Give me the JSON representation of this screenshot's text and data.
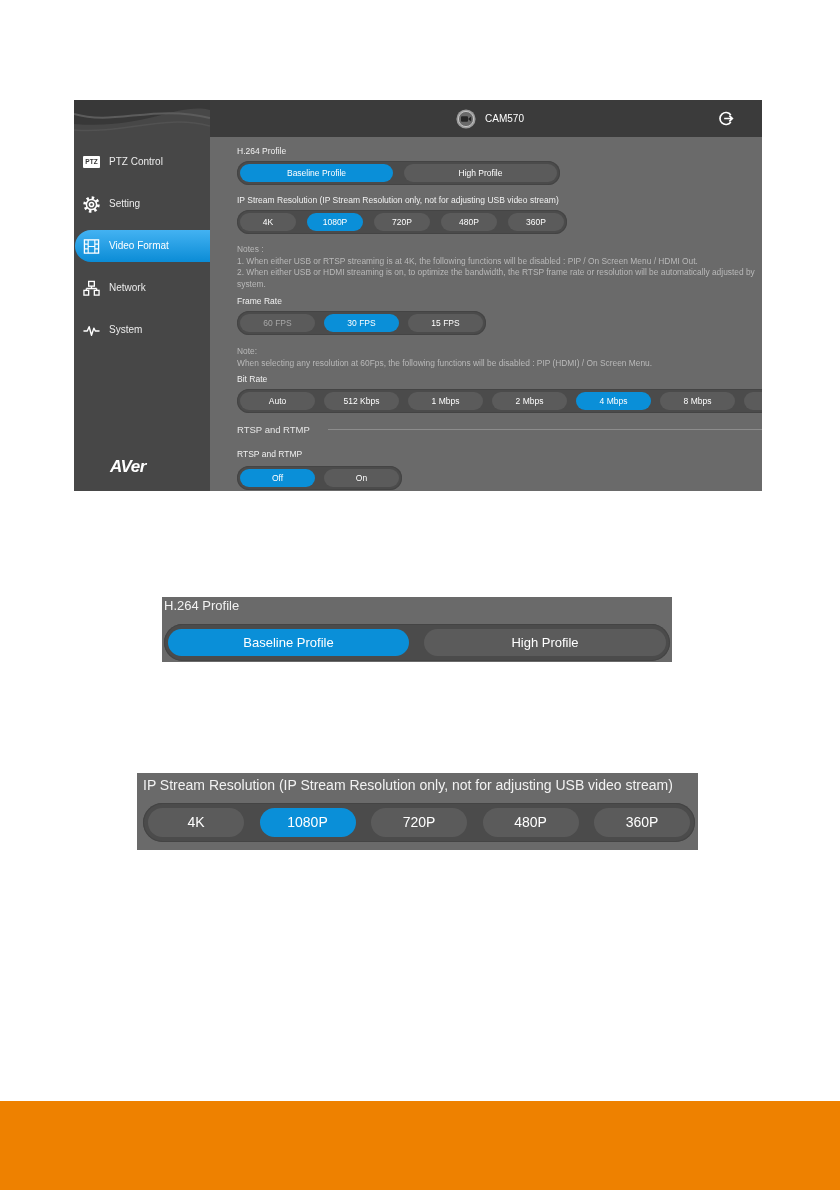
{
  "app_screenshot": {
    "sidebar": {
      "items": [
        {
          "label": "PTZ Control",
          "icon_text": "PTZ",
          "selected": false
        },
        {
          "label": "Setting",
          "selected": false
        },
        {
          "label": "Video Format",
          "selected": true
        },
        {
          "label": "Network",
          "selected": false
        },
        {
          "label": "System",
          "selected": false
        }
      ],
      "logo": "AVer"
    },
    "header": {
      "device_name": "CAM570"
    },
    "h264_profile": {
      "label": "H.264 Profile",
      "options": [
        {
          "label": "Baseline Profile",
          "selected": true
        },
        {
          "label": "High Profile",
          "selected": false
        }
      ]
    },
    "ip_stream_resolution": {
      "label": "IP Stream Resolution (IP Stream Resolution only, not for adjusting USB video stream)",
      "options": [
        {
          "label": "4K",
          "selected": false
        },
        {
          "label": "1080P",
          "selected": true
        },
        {
          "label": "720P",
          "selected": false
        },
        {
          "label": "480P",
          "selected": false
        },
        {
          "label": "360P",
          "selected": false
        }
      ]
    },
    "resolution_notes": {
      "title": "Notes :",
      "lines": [
        "1. When either USB or RTSP streaming is at 4K, the following functions will be disabled : PIP / On Screen Menu / HDMI Out.",
        "2. When either USB or HDMI streaming is on, to optimize the bandwidth, the RTSP frame rate or resolution will be automatically adjusted by system."
      ]
    },
    "frame_rate": {
      "label": "Frame Rate",
      "options": [
        {
          "label": "60 FPS",
          "selected": false,
          "disabled": true
        },
        {
          "label": "30 FPS",
          "selected": true,
          "disabled": false
        },
        {
          "label": "15 FPS",
          "selected": false,
          "disabled": false
        }
      ]
    },
    "frame_rate_note": {
      "title": "Note:",
      "lines": [
        "When selecting any resolution at 60Fps, the following functions will be disabled : PIP (HDMI) / On Screen Menu."
      ]
    },
    "bit_rate": {
      "label": "Bit Rate",
      "options": [
        {
          "label": "Auto",
          "selected": false
        },
        {
          "label": "512 Kbps",
          "selected": false
        },
        {
          "label": "1 Mbps",
          "selected": false
        },
        {
          "label": "2 Mbps",
          "selected": false
        },
        {
          "label": "4 Mbps",
          "selected": true
        },
        {
          "label": "8 Mbps",
          "selected": false
        }
      ],
      "more_options_cut_off": true
    },
    "rtsp_rtmp_section": {
      "title": "RTSP and RTMP"
    },
    "rtsp_rtmp": {
      "label": "RTSP and RTMP",
      "options": [
        {
          "label": "Off",
          "selected": true
        },
        {
          "label": "On",
          "selected": false
        }
      ]
    }
  },
  "h264_profile_closeup": {
    "label": "H.264 Profile",
    "options": [
      {
        "label": "Baseline Profile",
        "selected": true
      },
      {
        "label": "High Profile",
        "selected": false
      }
    ]
  },
  "ip_stream_resolution_closeup": {
    "label": "IP Stream Resolution (IP Stream Resolution only, not for adjusting USB video stream)",
    "options": [
      {
        "label": "4K",
        "selected": false
      },
      {
        "label": "1080P",
        "selected": true
      },
      {
        "label": "720P",
        "selected": false
      },
      {
        "label": "480P",
        "selected": false
      },
      {
        "label": "360P",
        "selected": false
      }
    ]
  }
}
